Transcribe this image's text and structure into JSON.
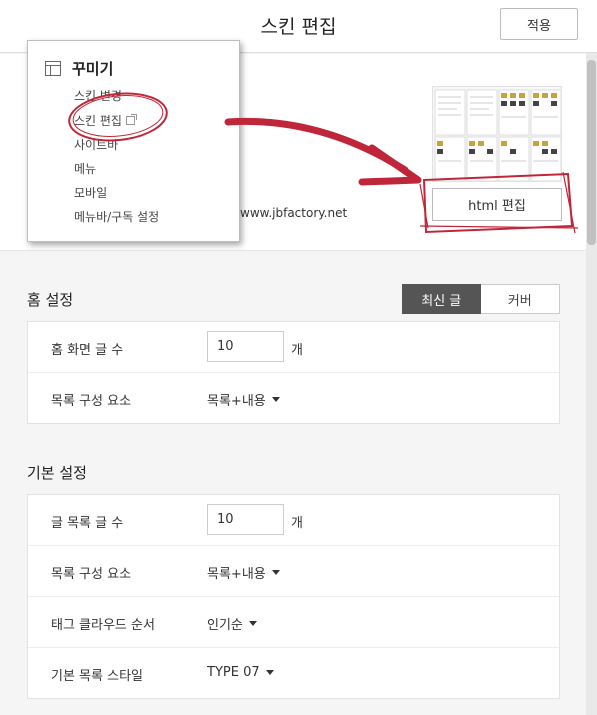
{
  "header": {
    "title": "스킨 편집",
    "apply_label": "적용"
  },
  "menu": {
    "heading": "꾸미기",
    "items": [
      {
        "label": "스킨 변경"
      },
      {
        "label": "스킨 편집"
      },
      {
        "label": "사이트바"
      },
      {
        "label": "메뉴"
      },
      {
        "label": "모바일"
      },
      {
        "label": "메뉴바/구독 설정"
      }
    ]
  },
  "preview": {
    "url_text": "www.jbfactory.net",
    "html_edit_label": "html 편집"
  },
  "home_settings": {
    "title": "홈 설정",
    "tabs": [
      {
        "label": "최신 글",
        "active": true
      },
      {
        "label": "커버",
        "active": false
      }
    ],
    "post_count_label": "홈 화면 글 수",
    "post_count_value": "10",
    "post_count_unit": "개",
    "list_elements_label": "목록 구성 요소",
    "list_elements_value": "목록+내용"
  },
  "basic_settings": {
    "title": "기본 설정",
    "post_count_label": "글 목록 글 수",
    "post_count_value": "10",
    "post_count_unit": "개",
    "list_elements_label": "목록 구성 요소",
    "list_elements_value": "목록+내용",
    "tag_cloud_label": "태그 클라우드 순서",
    "tag_cloud_value": "인기순",
    "list_style_label": "기본 목록 스타일",
    "list_style_value": "TYPE 07"
  },
  "annotation_color": "#c0263a"
}
